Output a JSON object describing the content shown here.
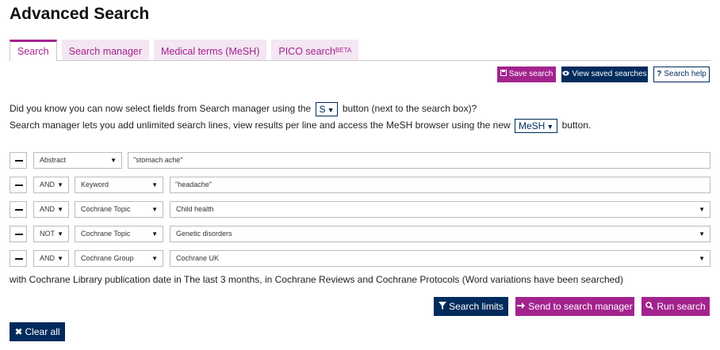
{
  "page": {
    "title": "Advanced Search"
  },
  "tabs": [
    {
      "label": "Search",
      "active": true
    },
    {
      "label": "Search manager"
    },
    {
      "label": "Medical terms (MeSH)"
    },
    {
      "label": "PICO search",
      "sup": "BETA"
    }
  ],
  "toolbar": {
    "save_label": "Save search",
    "view_saved_label": "View saved searches",
    "help_label": "Search help",
    "save_icon": "floppy-disk-icon",
    "view_icon": "eye-icon",
    "help_icon": "question-icon"
  },
  "info": {
    "line1_pre": "Did you know you can now select fields from Search manager using the",
    "line1_btn": "S",
    "line1_post": "button (next to the search box)?",
    "line2_pre": "Search manager lets you add unlimited search lines, view results per line and access the MeSH browser using the new",
    "line2_btn": "MeSH",
    "line2_post": "button."
  },
  "rows": [
    {
      "operator": "",
      "field": "Abstract",
      "value": "\"stomach ache\"",
      "value_type": "text"
    },
    {
      "operator": "AND",
      "field": "Keyword",
      "value": "\"headache\"",
      "value_type": "text"
    },
    {
      "operator": "AND",
      "field": "Cochrane Topic",
      "value": "Child health",
      "value_type": "select"
    },
    {
      "operator": "NOT",
      "field": "Cochrane Topic",
      "value": "Genetic disorders",
      "value_type": "select"
    },
    {
      "operator": "AND",
      "field": "Cochrane Group",
      "value": "Cochrane UK",
      "value_type": "select"
    }
  ],
  "summary": "with Cochrane Library publication date in The last 3 months, in Cochrane Reviews and Cochrane Protocols (Word variations have been searched)",
  "actions": {
    "search_limits": "Search limits",
    "send_to_manager": "Send to search manager",
    "run_search": "Run search",
    "clear_all": "Clear all"
  },
  "colors": {
    "magenta": "#a3238e",
    "navy": "#002b5c",
    "tab_bg": "#f4e6f3"
  }
}
